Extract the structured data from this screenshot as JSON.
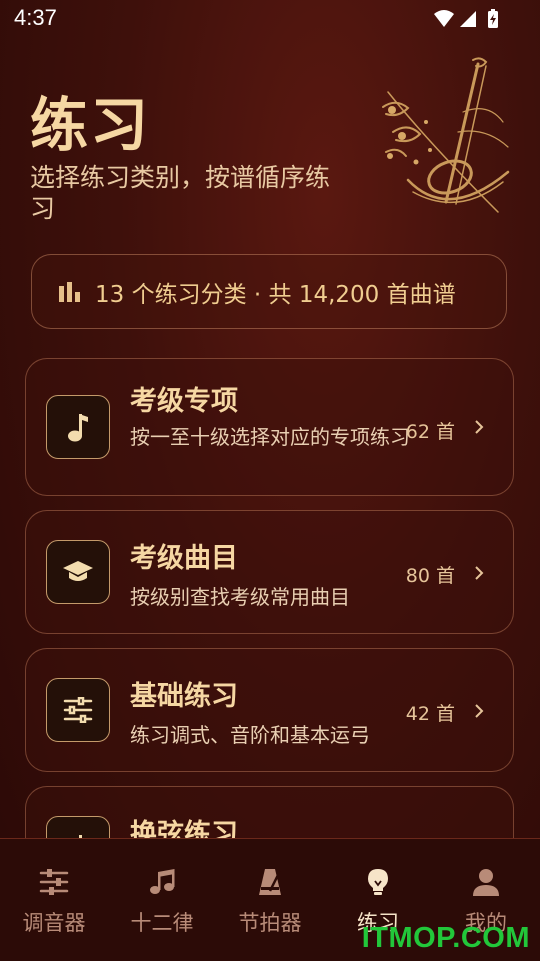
{
  "status_bar": {
    "time": "4:37"
  },
  "header": {
    "title": "练习",
    "subtitle": "选择练习类别，按谱循序练习"
  },
  "summary": {
    "text": "13 个练习分类 · 共 14,200 首曲谱"
  },
  "categories": [
    {
      "title": "考级专项",
      "description": "按一至十级选择对应的专项练习",
      "count": "62 首",
      "icon": "music-note-icon"
    },
    {
      "title": "考级曲目",
      "description": "按级别查找考级常用曲目",
      "count": "80 首",
      "icon": "graduation-cap-icon"
    },
    {
      "title": "基础练习",
      "description": "练习调式、音阶和基本运弓",
      "count": "42 首",
      "icon": "sliders-icon"
    },
    {
      "title": "换弦练习",
      "description": "",
      "count": "",
      "icon": "music-note-icon"
    }
  ],
  "tabs": [
    {
      "label": "调音器",
      "icon": "tuner-sliders-icon"
    },
    {
      "label": "十二律",
      "icon": "music-notes-icon"
    },
    {
      "label": "节拍器",
      "icon": "metronome-icon"
    },
    {
      "label": "练习",
      "icon": "lightbulb-icon",
      "active": true
    },
    {
      "label": "我的",
      "icon": "person-icon"
    }
  ],
  "watermark": "ITMOP.COM"
}
